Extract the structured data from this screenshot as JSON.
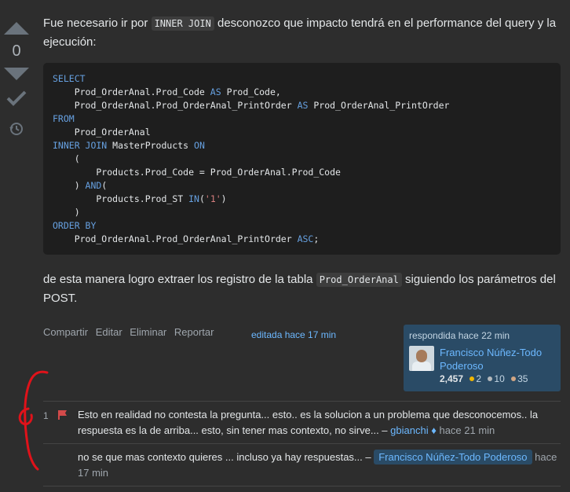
{
  "vote": {
    "count": "0"
  },
  "post": {
    "para1_a": "Fue necesario ir por ",
    "para1_code": "INNER JOIN",
    "para1_b": " desconozco que impacto tendrá en el performance del query y la ejecución:",
    "code_lines": [
      [
        {
          "t": "SELECT",
          "k": "kw"
        }
      ],
      [
        {
          "t": "    Prod_OrderAnal.Prod_Code "
        },
        {
          "t": "AS",
          "k": "kw"
        },
        {
          "t": " Prod_Code,"
        }
      ],
      [
        {
          "t": "    Prod_OrderAnal.Prod_OrderAnal_PrintOrder "
        },
        {
          "t": "AS",
          "k": "kw"
        },
        {
          "t": " Prod_OrderAnal_PrintOrder"
        }
      ],
      [
        {
          "t": "FROM",
          "k": "kw"
        }
      ],
      [
        {
          "t": "    Prod_OrderAnal"
        }
      ],
      [
        {
          "t": "INNER JOIN",
          "k": "kw"
        },
        {
          "t": " MasterProducts "
        },
        {
          "t": "ON",
          "k": "kw"
        }
      ],
      [
        {
          "t": "    ("
        }
      ],
      [
        {
          "t": "        Products.Prod_Code = Prod_OrderAnal.Prod_Code"
        }
      ],
      [
        {
          "t": "    ) "
        },
        {
          "t": "AND",
          "k": "kw"
        },
        {
          "t": "("
        }
      ],
      [
        {
          "t": "        Products.Prod_ST "
        },
        {
          "t": "IN",
          "k": "kw"
        },
        {
          "t": "("
        },
        {
          "t": "'1'",
          "k": "str"
        },
        {
          "t": ")"
        }
      ],
      [
        {
          "t": "    )"
        }
      ],
      [
        {
          "t": "ORDER BY",
          "k": "kw"
        }
      ],
      [
        {
          "t": "    Prod_OrderAnal.Prod_OrderAnal_PrintOrder "
        },
        {
          "t": "ASC",
          "k": "kw"
        },
        {
          "t": ";"
        }
      ]
    ],
    "para2_a": "de esta manera logro extraer los registro de la tabla ",
    "para2_code": "Prod_OrderAnal",
    "para2_b": " siguiendo los parámetros del POST."
  },
  "actions": {
    "share": "Compartir",
    "edit": "Editar",
    "delete": "Eliminar",
    "report": "Reportar",
    "edited": "editada hace 17 min"
  },
  "usercard": {
    "answered": "respondida hace 22 min",
    "name": "Francisco Núñez-Todo Poderoso",
    "reputation": "2,457",
    "gold": "2",
    "silver": "10",
    "bronze": "35",
    "colors": {
      "gold": "#f1b600",
      "silver": "#b4b8bc",
      "bronze": "#d1a684"
    }
  },
  "comments": [
    {
      "score": "1",
      "text": "Esto en realidad no contesta la pregunta... esto.. es la solucion a un problema que desconocemos.. la respuesta es la de arriba... esto, sin tener mas contexto, no sirve... – ",
      "user": "gbianchi",
      "badge": "♦",
      "time": " hace 21 min"
    },
    {
      "score": "",
      "text": "no se que mas contexto quieres ... incluso ya hay respuestas... – ",
      "user": "Francisco Núñez-Todo Poderoso",
      "time": " hace 17 min"
    }
  ]
}
